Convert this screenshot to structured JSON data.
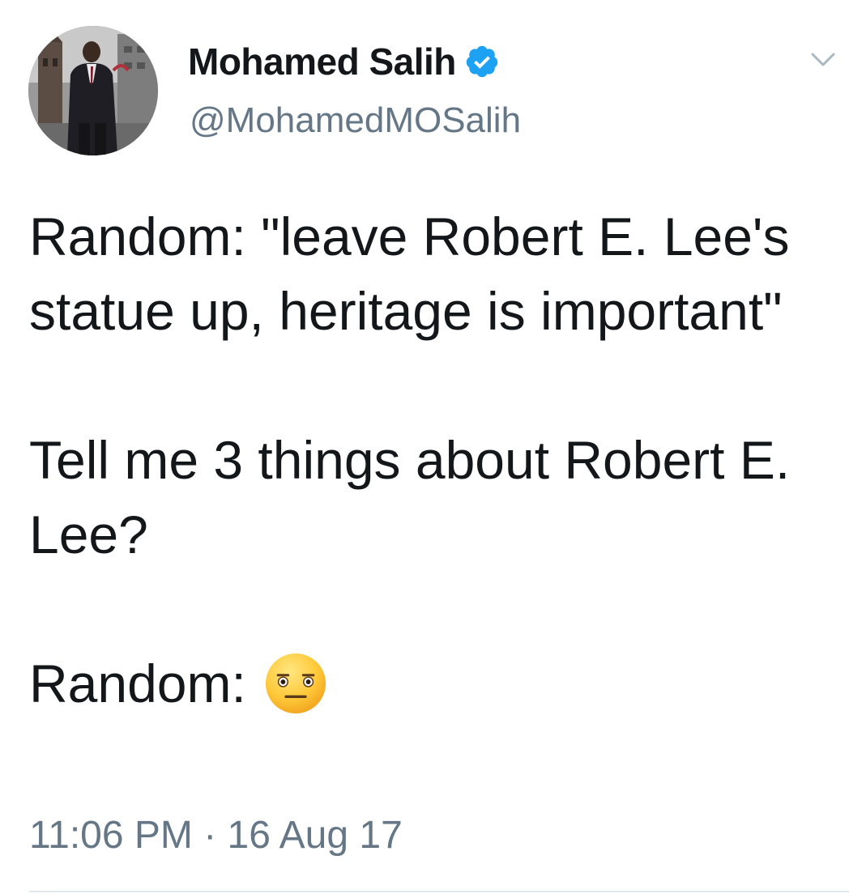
{
  "author": {
    "display_name": "Mohamed Salih",
    "handle": "@MohamedMOSalih",
    "verified": true
  },
  "tweet": {
    "paragraphs": [
      "Random: \"leave Robert E. Lee's statue up, heritage is important\"",
      "Tell me 3 things about Robert E. Lee?"
    ],
    "last_line_text": "Random:",
    "last_line_emoji": "neutral-face-emoji"
  },
  "meta": {
    "timestamp": "11:06 PM · 16 Aug 17"
  },
  "icons": {
    "verified": "verified-badge-icon",
    "more": "chevron-down-icon"
  },
  "colors": {
    "verified_blue": "#1da1f2",
    "text": "#14171a",
    "secondary_text": "#657786",
    "divider": "#e1e8ed"
  }
}
